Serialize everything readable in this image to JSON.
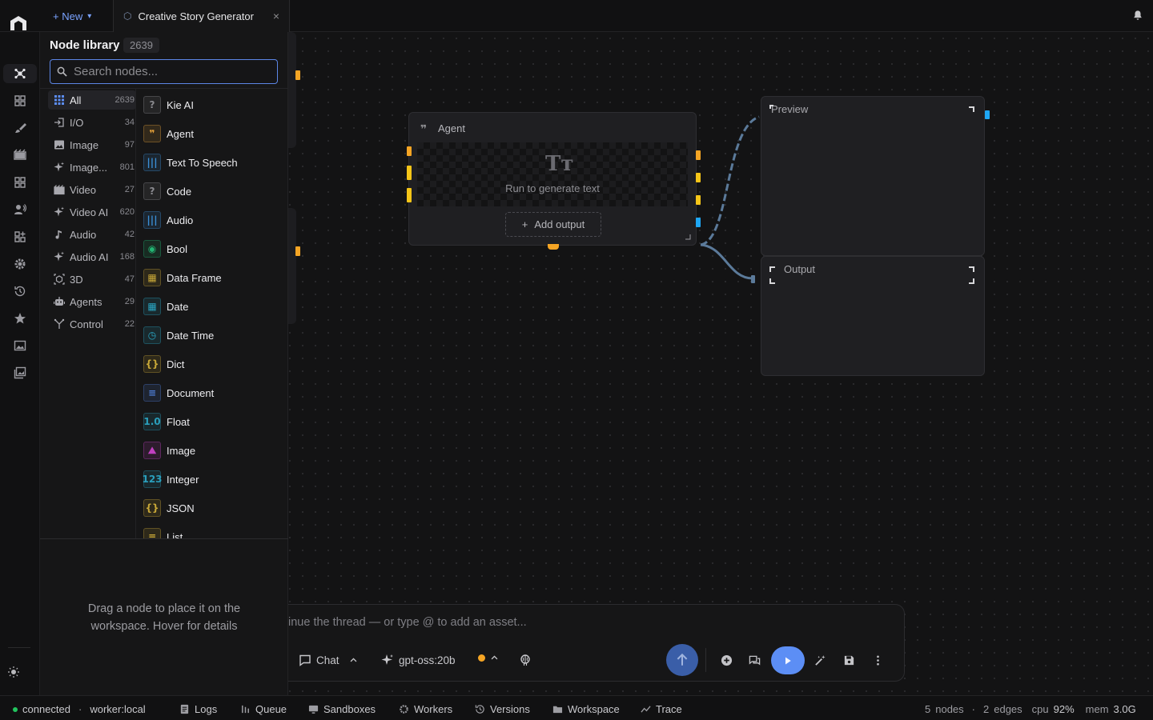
{
  "header": {
    "new_label": "+ New",
    "new_caret": "▾",
    "tab_label": "Creative Story Generator",
    "tab_close": "×"
  },
  "library": {
    "title": "Node library",
    "count": "2639",
    "search_placeholder": "Search nodes...",
    "categories": [
      {
        "label": "All",
        "count": "2639",
        "icon": "grid-icon"
      },
      {
        "label": "I/O",
        "count": "34",
        "icon": "login-icon"
      },
      {
        "label": "Image",
        "count": "97",
        "icon": "image-icon"
      },
      {
        "label": "Image...",
        "count": "801",
        "icon": "sparkle-icon"
      },
      {
        "label": "Video",
        "count": "27",
        "icon": "film-icon"
      },
      {
        "label": "Video AI",
        "count": "620",
        "icon": "sparkle-icon"
      },
      {
        "label": "Audio",
        "count": "42",
        "icon": "music-note-icon"
      },
      {
        "label": "Audio AI",
        "count": "168",
        "icon": "sparkle-icon"
      },
      {
        "label": "3D",
        "count": "47",
        "icon": "cube-icon"
      },
      {
        "label": "Agents",
        "count": "29",
        "icon": "robot-icon"
      },
      {
        "label": "Control",
        "count": "22",
        "icon": "fork-icon"
      }
    ],
    "nodes": [
      {
        "label": "Kie AI",
        "icon_text": "?",
        "color": "#8a8a8f"
      },
      {
        "label": "Agent",
        "icon_text": "❞",
        "color": "#e8a33a"
      },
      {
        "label": "Text To Speech",
        "icon_text": "|||",
        "color": "#3b8fd6"
      },
      {
        "label": "Code",
        "icon_text": "?",
        "color": "#8a8a8f"
      },
      {
        "label": "Audio",
        "icon_text": "|||",
        "color": "#3b8fd6"
      },
      {
        "label": "Bool",
        "icon_text": "◉",
        "color": "#22b573"
      },
      {
        "label": "Data Frame",
        "icon_text": "▦",
        "color": "#c8a838"
      },
      {
        "label": "Date",
        "icon_text": "▦",
        "color": "#2aa7c4"
      },
      {
        "label": "Date Time",
        "icon_text": "◷",
        "color": "#2aa7c4"
      },
      {
        "label": "Dict",
        "icon_text": "{}",
        "color": "#c8a838"
      },
      {
        "label": "Document",
        "icon_text": "≡",
        "color": "#4f7fd8"
      },
      {
        "label": "Float",
        "icon_text": "1.0",
        "color": "#2a9fbc"
      },
      {
        "label": "Image",
        "icon_text": "⛰",
        "color": "#c040c0"
      },
      {
        "label": "Integer",
        "icon_text": "123",
        "color": "#2a9fbc"
      },
      {
        "label": "JSON",
        "icon_text": "{}",
        "color": "#c8a838"
      },
      {
        "label": "List",
        "icon_text": "≡",
        "color": "#c8a838"
      }
    ],
    "hint": "Drag a node to place it on the workspace. Hover for details"
  },
  "canvas": {
    "agent": {
      "title": "Agent",
      "icon_text": "❞",
      "placeholder_glyph": "Tт",
      "run_text": "Run to generate text",
      "add_output_label": "Add output",
      "add_output_icon": "+"
    },
    "preview_title": "Preview",
    "output_title": "Output"
  },
  "chat": {
    "placeholder": "inue the thread — or type @ to add an asset...",
    "mode_label": "Chat",
    "model_label": "gpt-oss:20b"
  },
  "status": {
    "connection": "connected",
    "worker": "worker:local",
    "links": [
      "Logs",
      "Queue",
      "Sandboxes",
      "Workers",
      "Versions",
      "Workspace",
      "Trace"
    ],
    "nodes_count": "5",
    "nodes_word": "nodes",
    "edges_count": "2",
    "edges_word": "edges",
    "cpu_label": "cpu",
    "cpu_value": "92%",
    "mem_label": "mem",
    "mem_value": "3.0G"
  },
  "colors": {
    "accent": "#5c8ef5",
    "port_orange": "#f5a524",
    "port_yellow": "#f5c518",
    "port_blue": "#1ea7f5",
    "edge": "#5b7a9a",
    "status_green": "#22c55e"
  }
}
